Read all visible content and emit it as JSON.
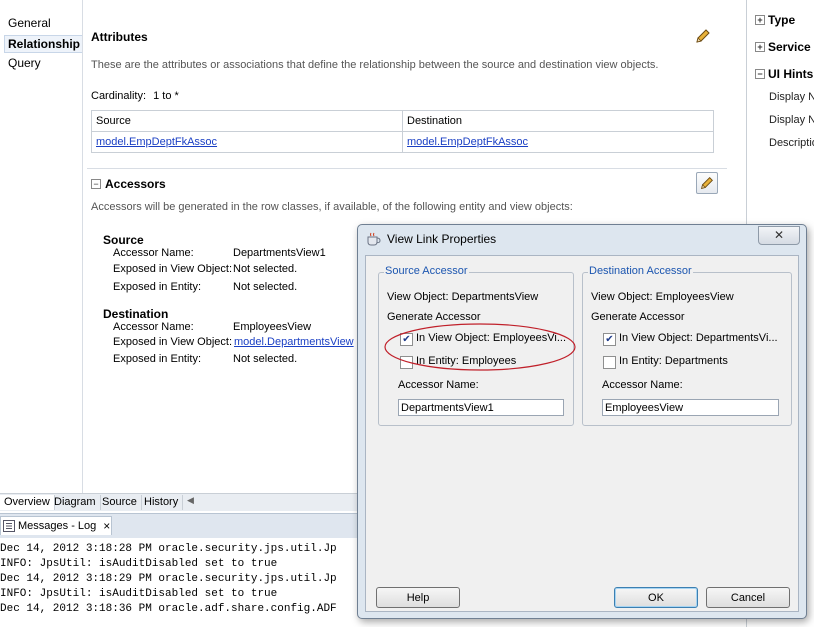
{
  "left_nav": {
    "items": [
      "General",
      "Relationship",
      "Query"
    ]
  },
  "attributes": {
    "title": "Attributes",
    "description": "These are the attributes or associations that define the relationship between the source and destination view objects.",
    "cardinality_label": "Cardinality:",
    "cardinality_value": "1 to *",
    "table": {
      "headers": [
        "Source",
        "Destination"
      ],
      "rows": [
        [
          "model.EmpDeptFkAssoc",
          "model.EmpDeptFkAssoc"
        ]
      ]
    }
  },
  "accessors": {
    "expander": "−",
    "title": "Accessors",
    "description": "Accessors will be generated in the row classes, if available, of the following entity and view objects:",
    "source": {
      "heading": "Source",
      "rows": [
        {
          "label": "Accessor Name:",
          "value": "DepartmentsView1"
        },
        {
          "label": "Exposed in View Object:",
          "value": "Not selected."
        },
        {
          "label": "Exposed in Entity:",
          "value": "Not selected."
        }
      ]
    },
    "destination": {
      "heading": "Destination",
      "rows": [
        {
          "label": "Accessor Name:",
          "value": "EmployeesView"
        },
        {
          "label": "Exposed in View Object:",
          "value": "model.DepartmentsView"
        },
        {
          "label": "Exposed in Entity:",
          "value": "Not selected."
        }
      ]
    }
  },
  "right_panel": {
    "sections": [
      {
        "label": "Type",
        "expander": "+"
      },
      {
        "label": "Service",
        "expander": "+"
      },
      {
        "label": "UI Hints",
        "expander": "−"
      }
    ],
    "fields": [
      "Display Na",
      "Display Na",
      "Descriptio"
    ]
  },
  "bottom_tabs": [
    "Overview",
    "Diagram",
    "Source",
    "History"
  ],
  "log": {
    "title": "Messages - Log",
    "close": "×",
    "lines": [
      "Dec 14, 2012 3:18:28 PM oracle.security.jps.util.Jp",
      "INFO: JpsUtil: isAuditDisabled set to true",
      "Dec 14, 2012 3:18:29 PM oracle.security.jps.util.Jp",
      "INFO: JpsUtil: isAuditDisabled set to true",
      "Dec 14, 2012 3:18:36 PM oracle.adf.share.config.ADF"
    ]
  },
  "dialog": {
    "title": "View Link Properties",
    "close": "✕",
    "source": {
      "legend": "Source Accessor",
      "view_object": "View Object: DepartmentsView",
      "generate": "Generate Accessor",
      "cb_view_object": "In View Object: EmployeesVi...",
      "cb_view_object_checked": true,
      "cb_entity": "In Entity: Employees",
      "cb_entity_checked": false,
      "accessor_name_label": "Accessor Name:",
      "accessor_name_value": "DepartmentsView1"
    },
    "destination": {
      "legend": "Destination Accessor",
      "view_object": "View Object: EmployeesView",
      "generate": "Generate Accessor",
      "cb_view_object": "In View Object: DepartmentsVi...",
      "cb_view_object_checked": true,
      "cb_entity": "In Entity: Departments",
      "cb_entity_checked": false,
      "accessor_name_label": "Accessor Name:",
      "accessor_name_value": "EmployeesView"
    },
    "buttons": {
      "help": "Help",
      "ok": "OK",
      "cancel": "Cancel"
    }
  },
  "colors": {
    "link": "#1a3fc4",
    "legend": "#1c56b0",
    "highlight_ellipse": "#c0202a"
  }
}
